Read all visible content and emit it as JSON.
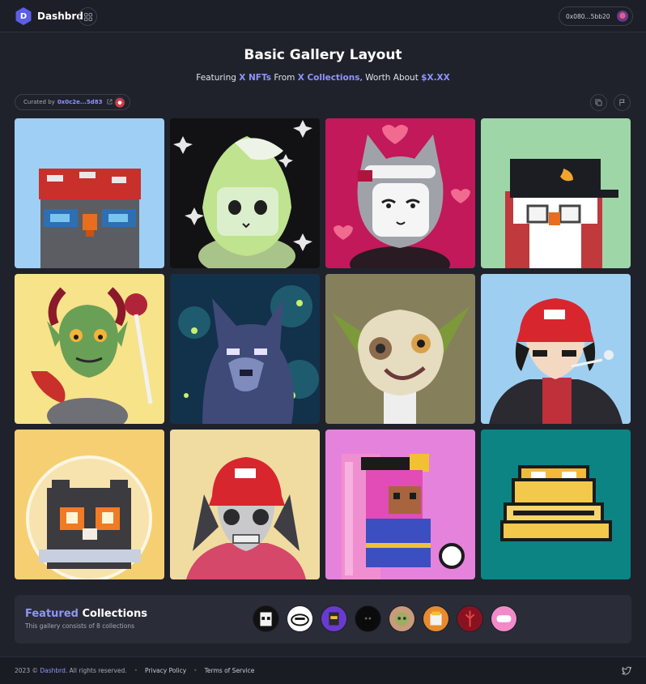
{
  "header": {
    "brand": "Dashbrd",
    "logo_letter": "D",
    "wallet_address": "0x080...5bb20"
  },
  "gallery": {
    "title": "Basic Gallery Layout",
    "subtitle": {
      "prefix": "Featuring",
      "nfts": "X NFTs",
      "from": "From",
      "collections": "X Collections",
      "worth": ", Worth About",
      "value": "$X.XX"
    },
    "curated_label": "Curated by",
    "curator_address": "0x0c2e...5d83",
    "nfts": [
      {
        "name": "nft-owl-red-bandana"
      },
      {
        "name": "nft-green-leaf-creature"
      },
      {
        "name": "nft-maid-cat"
      },
      {
        "name": "nft-owl-black-cap"
      },
      {
        "name": "nft-green-devil"
      },
      {
        "name": "nft-blue-wolf"
      },
      {
        "name": "nft-goblin-mask"
      },
      {
        "name": "nft-boy-red-cap"
      },
      {
        "name": "nft-astronaut-cat"
      },
      {
        "name": "nft-skeleton-red-cap"
      },
      {
        "name": "nft-pink-pizza-creature"
      },
      {
        "name": "nft-golden-frog"
      }
    ]
  },
  "featured": {
    "title_highlight": "Featured",
    "title_rest": "Collections",
    "description": "This gallery consists of 8 collections",
    "collections": [
      "collection-1",
      "collection-2",
      "collection-3",
      "collection-4",
      "collection-5",
      "collection-6",
      "collection-7",
      "collection-8"
    ]
  },
  "footer": {
    "copyright_prefix": "2023 ©",
    "brand": "Dashbrd",
    "rights": ". All rights reserved.",
    "privacy": "Privacy Policy",
    "terms": "Terms of Service"
  },
  "colors": {
    "accent": "#8f94ff",
    "background": "#1f222b"
  }
}
